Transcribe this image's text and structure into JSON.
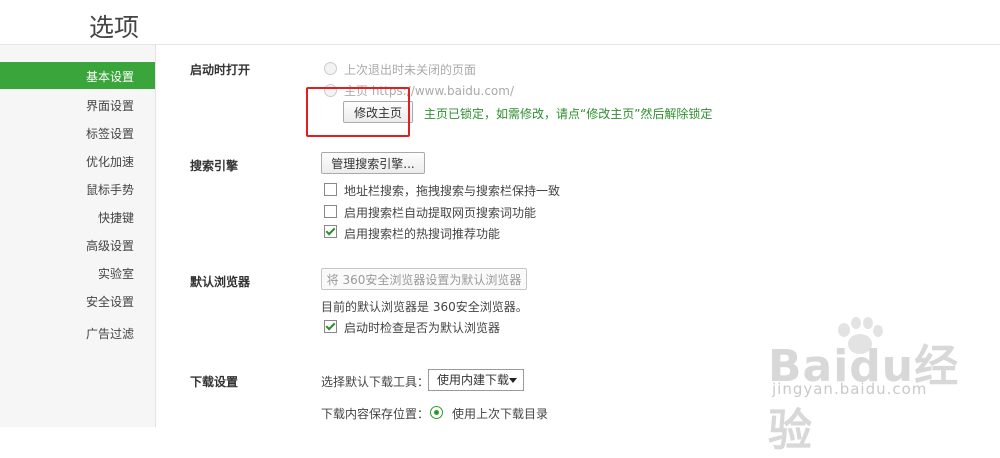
{
  "page_title": "选项",
  "sidebar": {
    "items": [
      {
        "label": "基本设置",
        "active": true
      },
      {
        "label": "界面设置"
      },
      {
        "label": "标签设置"
      },
      {
        "label": "优化加速"
      },
      {
        "label": "鼠标手势"
      },
      {
        "label": "快捷键"
      },
      {
        "label": "高级设置"
      },
      {
        "label": "实验室"
      },
      {
        "label": "安全设置"
      },
      {
        "label": "广告过滤"
      }
    ]
  },
  "startup": {
    "heading": "启动时打开",
    "option_last_session": "上次退出时未关闭的页面",
    "option_homepage": "主页   https://www.baidu.com/",
    "modify_home_button": "修改主页",
    "lock_notice": "主页已锁定，如需修改，请点“修改主页”然后解除锁定"
  },
  "search": {
    "heading": "搜索引擎",
    "manage_button": "管理搜索引擎...",
    "options": [
      {
        "label": "地址栏搜索，拖拽搜索与搜索栏保持一致",
        "checked": false
      },
      {
        "label": "启用搜索栏自动提取网页搜索词功能",
        "checked": false
      },
      {
        "label": "启用搜索栏的热搜词推荐功能",
        "checked": true
      }
    ]
  },
  "default_browser": {
    "heading": "默认浏览器",
    "set_default_button": "将 360安全浏览器设置为默认浏览器",
    "status_text": "目前的默认浏览器是 360安全浏览器。",
    "check_on_startup": {
      "label": "启动时检查是否为默认浏览器",
      "checked": true
    }
  },
  "download": {
    "heading": "下载设置",
    "tool_label": "选择默认下载工具：",
    "tool_value": "使用内建下载",
    "save_location_label": "下载内容保存位置：",
    "save_location_option": "使用上次下载目录"
  },
  "watermark": {
    "text": "Baidu经验",
    "url": "jingyan.baidu.com"
  },
  "colors": {
    "accent_green": "#3aa53a",
    "highlight_red": "#e02020"
  }
}
